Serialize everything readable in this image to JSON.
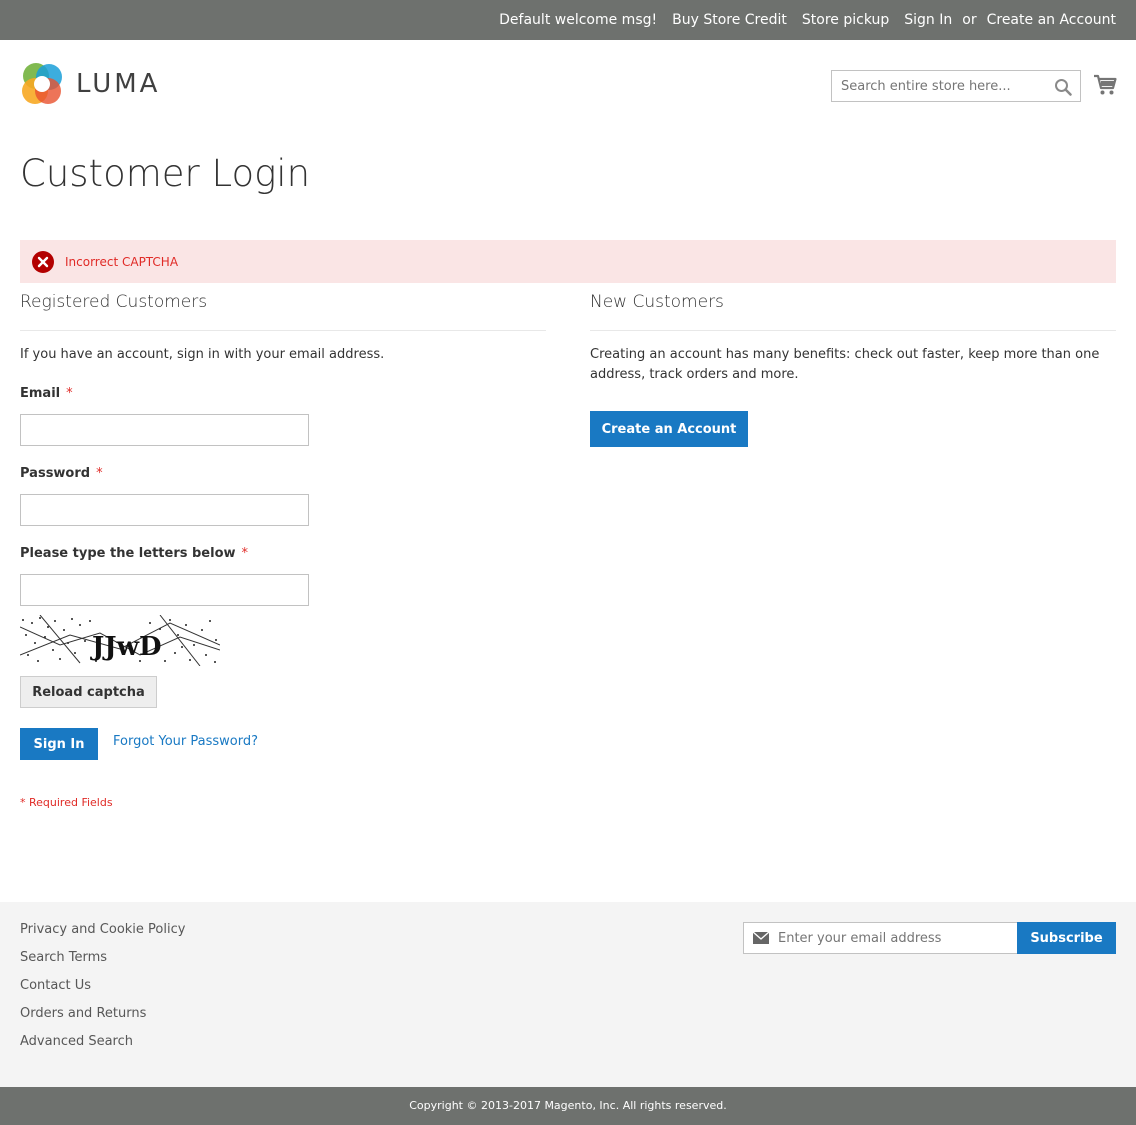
{
  "header": {
    "links": [
      {
        "label": "Default welcome msg!",
        "link": false
      },
      {
        "label": "Buy Store Credit",
        "link": true
      },
      {
        "label": "Store pickup",
        "link": true
      },
      {
        "label": "Sign In",
        "link": true
      },
      {
        "label": "or",
        "link": false
      },
      {
        "label": "Create an Account",
        "link": true
      }
    ],
    "logo_text": "LUMA",
    "search_placeholder": "Search entire store here..."
  },
  "page": {
    "title": "Customer Login",
    "error_message": "Incorrect CAPTCHA"
  },
  "registered": {
    "title": "Registered Customers",
    "intro": "If you have an account, sign in with your email address.",
    "email_label": "Email",
    "password_label": "Password",
    "captcha_label": "Please type the letters below",
    "required_mark": "*",
    "captcha_text": "JJwD",
    "reload_button": "Reload captcha",
    "signin_button": "Sign In",
    "forgot_link": "Forgot Your Password?",
    "required_note": "* Required Fields"
  },
  "new_customers": {
    "title": "New Customers",
    "intro": "Creating an account has many benefits: check out faster, keep more than one address, track orders and more.",
    "create_button": "Create an Account"
  },
  "footer": {
    "links": [
      "Privacy and Cookie Policy",
      "Search Terms",
      "Contact Us",
      "Orders and Returns",
      "Advanced Search"
    ],
    "newsletter_placeholder": "Enter your email address",
    "subscribe_button": "Subscribe",
    "copyright": "Copyright © 2013-2017 Magento, Inc. All rights reserved."
  },
  "colors": {
    "topbar": "#6e716e",
    "primary": "#1979c3",
    "error": "#e02b27",
    "error_bg": "#fae5e5",
    "footer_bg": "#f4f4f4"
  },
  "icons": [
    "search-icon",
    "cart-icon",
    "error-icon",
    "mail-icon",
    "luma-logo-icon"
  ]
}
